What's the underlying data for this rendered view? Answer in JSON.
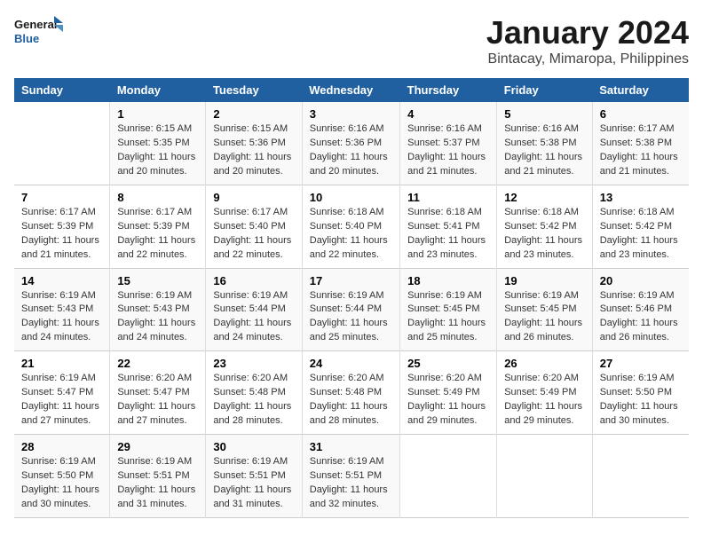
{
  "logo": {
    "line1": "General",
    "line2": "Blue"
  },
  "title": "January 2024",
  "subtitle": "Bintacay, Mimaropa, Philippines",
  "days_of_week": [
    "Sunday",
    "Monday",
    "Tuesday",
    "Wednesday",
    "Thursday",
    "Friday",
    "Saturday"
  ],
  "weeks": [
    [
      {
        "num": "",
        "detail": ""
      },
      {
        "num": "1",
        "detail": "Sunrise: 6:15 AM\nSunset: 5:35 PM\nDaylight: 11 hours\nand 20 minutes."
      },
      {
        "num": "2",
        "detail": "Sunrise: 6:15 AM\nSunset: 5:36 PM\nDaylight: 11 hours\nand 20 minutes."
      },
      {
        "num": "3",
        "detail": "Sunrise: 6:16 AM\nSunset: 5:36 PM\nDaylight: 11 hours\nand 20 minutes."
      },
      {
        "num": "4",
        "detail": "Sunrise: 6:16 AM\nSunset: 5:37 PM\nDaylight: 11 hours\nand 21 minutes."
      },
      {
        "num": "5",
        "detail": "Sunrise: 6:16 AM\nSunset: 5:38 PM\nDaylight: 11 hours\nand 21 minutes."
      },
      {
        "num": "6",
        "detail": "Sunrise: 6:17 AM\nSunset: 5:38 PM\nDaylight: 11 hours\nand 21 minutes."
      }
    ],
    [
      {
        "num": "7",
        "detail": "Sunrise: 6:17 AM\nSunset: 5:39 PM\nDaylight: 11 hours\nand 21 minutes."
      },
      {
        "num": "8",
        "detail": "Sunrise: 6:17 AM\nSunset: 5:39 PM\nDaylight: 11 hours\nand 22 minutes."
      },
      {
        "num": "9",
        "detail": "Sunrise: 6:17 AM\nSunset: 5:40 PM\nDaylight: 11 hours\nand 22 minutes."
      },
      {
        "num": "10",
        "detail": "Sunrise: 6:18 AM\nSunset: 5:40 PM\nDaylight: 11 hours\nand 22 minutes."
      },
      {
        "num": "11",
        "detail": "Sunrise: 6:18 AM\nSunset: 5:41 PM\nDaylight: 11 hours\nand 23 minutes."
      },
      {
        "num": "12",
        "detail": "Sunrise: 6:18 AM\nSunset: 5:42 PM\nDaylight: 11 hours\nand 23 minutes."
      },
      {
        "num": "13",
        "detail": "Sunrise: 6:18 AM\nSunset: 5:42 PM\nDaylight: 11 hours\nand 23 minutes."
      }
    ],
    [
      {
        "num": "14",
        "detail": "Sunrise: 6:19 AM\nSunset: 5:43 PM\nDaylight: 11 hours\nand 24 minutes."
      },
      {
        "num": "15",
        "detail": "Sunrise: 6:19 AM\nSunset: 5:43 PM\nDaylight: 11 hours\nand 24 minutes."
      },
      {
        "num": "16",
        "detail": "Sunrise: 6:19 AM\nSunset: 5:44 PM\nDaylight: 11 hours\nand 24 minutes."
      },
      {
        "num": "17",
        "detail": "Sunrise: 6:19 AM\nSunset: 5:44 PM\nDaylight: 11 hours\nand 25 minutes."
      },
      {
        "num": "18",
        "detail": "Sunrise: 6:19 AM\nSunset: 5:45 PM\nDaylight: 11 hours\nand 25 minutes."
      },
      {
        "num": "19",
        "detail": "Sunrise: 6:19 AM\nSunset: 5:45 PM\nDaylight: 11 hours\nand 26 minutes."
      },
      {
        "num": "20",
        "detail": "Sunrise: 6:19 AM\nSunset: 5:46 PM\nDaylight: 11 hours\nand 26 minutes."
      }
    ],
    [
      {
        "num": "21",
        "detail": "Sunrise: 6:19 AM\nSunset: 5:47 PM\nDaylight: 11 hours\nand 27 minutes."
      },
      {
        "num": "22",
        "detail": "Sunrise: 6:20 AM\nSunset: 5:47 PM\nDaylight: 11 hours\nand 27 minutes."
      },
      {
        "num": "23",
        "detail": "Sunrise: 6:20 AM\nSunset: 5:48 PM\nDaylight: 11 hours\nand 28 minutes."
      },
      {
        "num": "24",
        "detail": "Sunrise: 6:20 AM\nSunset: 5:48 PM\nDaylight: 11 hours\nand 28 minutes."
      },
      {
        "num": "25",
        "detail": "Sunrise: 6:20 AM\nSunset: 5:49 PM\nDaylight: 11 hours\nand 29 minutes."
      },
      {
        "num": "26",
        "detail": "Sunrise: 6:20 AM\nSunset: 5:49 PM\nDaylight: 11 hours\nand 29 minutes."
      },
      {
        "num": "27",
        "detail": "Sunrise: 6:19 AM\nSunset: 5:50 PM\nDaylight: 11 hours\nand 30 minutes."
      }
    ],
    [
      {
        "num": "28",
        "detail": "Sunrise: 6:19 AM\nSunset: 5:50 PM\nDaylight: 11 hours\nand 30 minutes."
      },
      {
        "num": "29",
        "detail": "Sunrise: 6:19 AM\nSunset: 5:51 PM\nDaylight: 11 hours\nand 31 minutes."
      },
      {
        "num": "30",
        "detail": "Sunrise: 6:19 AM\nSunset: 5:51 PM\nDaylight: 11 hours\nand 31 minutes."
      },
      {
        "num": "31",
        "detail": "Sunrise: 6:19 AM\nSunset: 5:51 PM\nDaylight: 11 hours\nand 32 minutes."
      },
      {
        "num": "",
        "detail": ""
      },
      {
        "num": "",
        "detail": ""
      },
      {
        "num": "",
        "detail": ""
      }
    ]
  ]
}
